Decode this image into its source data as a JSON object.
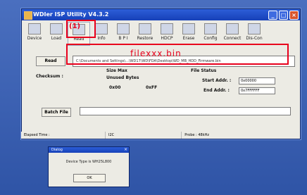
{
  "window": {
    "title": "WDIer ISP Utility V4.3.2"
  },
  "toolbar": {
    "items": [
      {
        "label": "Device"
      },
      {
        "label": "Load"
      },
      {
        "label": "Read"
      },
      {
        "label": "Info"
      },
      {
        "label": "B P I"
      },
      {
        "label": "Restore"
      },
      {
        "label": "HDCP"
      },
      {
        "label": "Erase"
      },
      {
        "label": "Config"
      },
      {
        "label": "Connect"
      },
      {
        "label": "Dis-Con"
      }
    ]
  },
  "annotation": {
    "marker": "(1)",
    "filename_overlay": "filexxx.bin"
  },
  "read": {
    "button": "Read",
    "path": "C:\\Documents and Settings\\...\\WD17\\WD\\FDA\\Desktop\\WD_MB_HDD_Firmware.bin"
  },
  "form": {
    "checksum_label": "Checksum :",
    "file_size_label": "Size Max",
    "unused_bytes_label": "Unused Bytes",
    "radio_00": "0x00",
    "radio_ff": "0xFF",
    "file_status_label": "File Status",
    "start_addr_label": "Start Addr. :",
    "start_addr_value": "0x00000",
    "end_addr_label": "End Addr. :",
    "end_addr_value": "0x7FFFFFF",
    "batch_button": "Batch File"
  },
  "status": {
    "elapsed": "Elapsed Time :",
    "mid": "I2C",
    "right": "Probe : 48kHz"
  },
  "dialog": {
    "title": "Dialog",
    "message": "Device Type is WH25L800",
    "ok": "OK"
  }
}
